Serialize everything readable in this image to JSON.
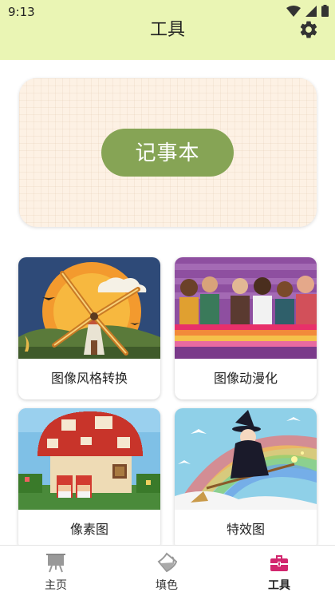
{
  "status_bar": {
    "time": "9:13"
  },
  "app_bar": {
    "title": "工具"
  },
  "notepad": {
    "label": "记事本"
  },
  "tools": [
    {
      "label": "图像风格转换"
    },
    {
      "label": "图像动漫化"
    },
    {
      "label": "像素图"
    },
    {
      "label": "特效图"
    }
  ],
  "bottom_nav": [
    {
      "label": "主页",
      "icon": "easel-icon",
      "active": false
    },
    {
      "label": "填色",
      "icon": "paint-bucket-icon",
      "active": false
    },
    {
      "label": "工具",
      "icon": "toolbox-icon",
      "active": true
    }
  ],
  "colors": {
    "accent": "#86a455",
    "active_nav": "#d2266e",
    "header_bg": "#eaf5b4"
  }
}
